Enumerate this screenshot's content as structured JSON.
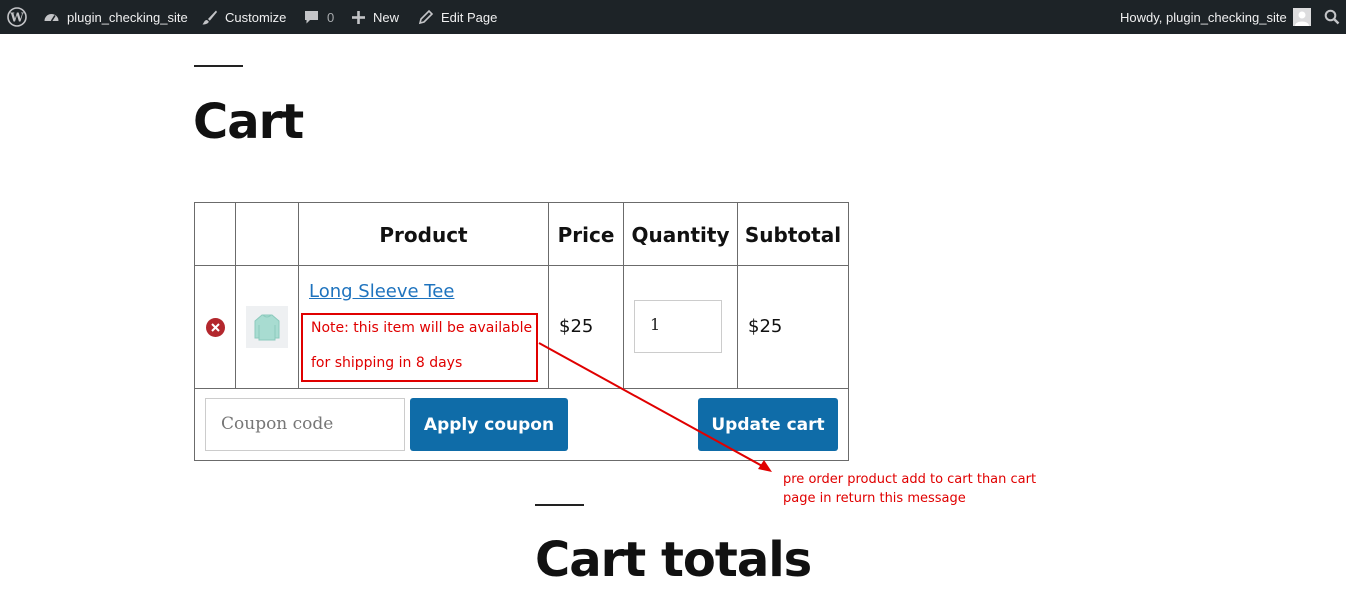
{
  "admin_bar": {
    "site_name": "plugin_checking_site",
    "customize": "Customize",
    "comments_count": "0",
    "new": "New",
    "edit_page": "Edit Page",
    "howdy": "Howdy, plugin_checking_site"
  },
  "page": {
    "title": "Cart",
    "totals_title": "Cart totals"
  },
  "cart_table": {
    "headers": {
      "product": "Product",
      "price": "Price",
      "quantity": "Quantity",
      "subtotal": "Subtotal"
    },
    "rows": [
      {
        "product_name": "Long Sleeve Tee",
        "note_line1": "Note: this item will be available",
        "note_line2": "for shipping in 8 days",
        "price": "$25",
        "quantity": "1",
        "subtotal": "$25"
      }
    ],
    "coupon_placeholder": "Coupon code",
    "apply_coupon_label": "Apply coupon",
    "update_cart_label": "Update cart"
  },
  "annotation": {
    "line1": "pre order product add to cart than cart",
    "line2": "page in return this message"
  },
  "colors": {
    "admin_bar_bg": "#1d2327",
    "button_bg": "#0f6ca8",
    "link": "#1e73be",
    "annotation_red": "#e00000",
    "remove_red": "#b3272d"
  }
}
